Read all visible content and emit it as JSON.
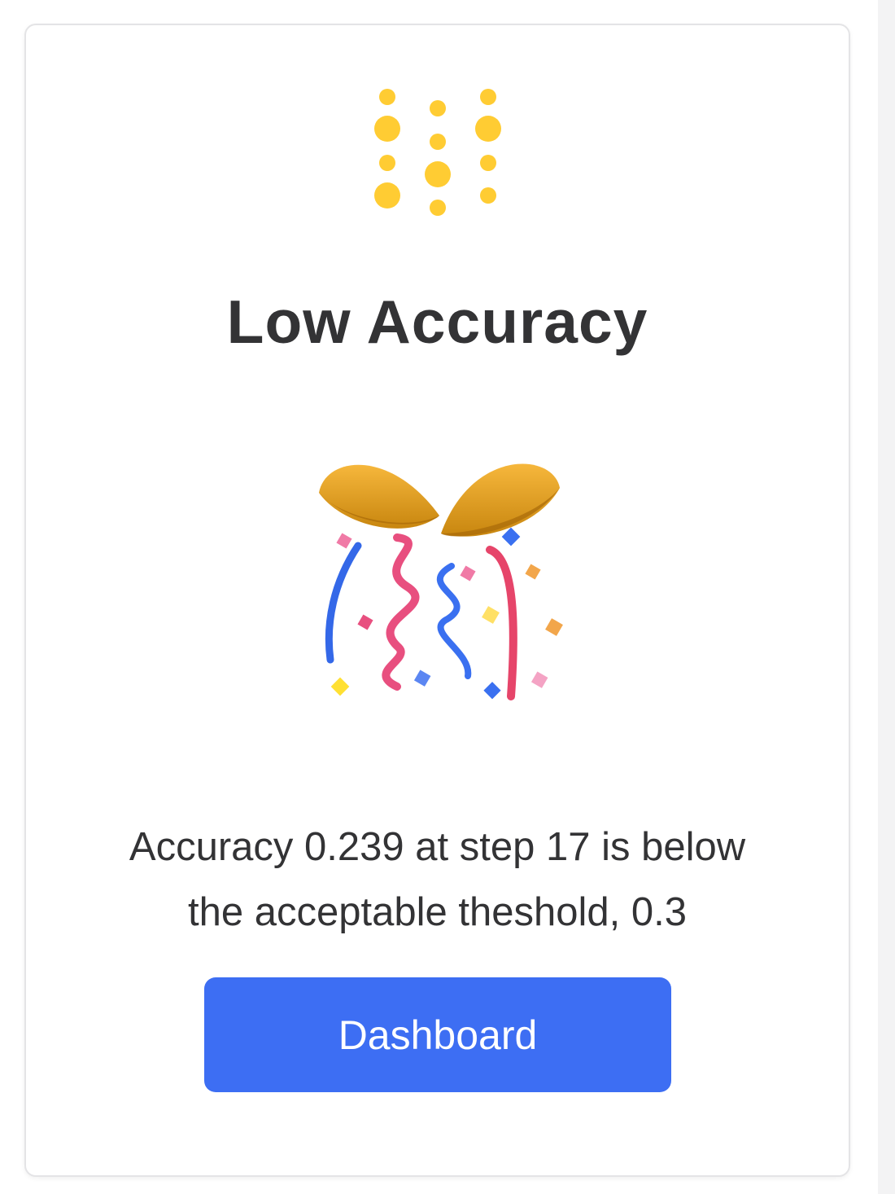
{
  "card": {
    "logo_icon": "wandb-logo-icon",
    "title": "Low Accuracy",
    "emoji_icon": "party-popper-icon",
    "message_line1": "Accuracy 0.239 at step 17 is below",
    "message_line2": "the acceptable theshold, 0.3",
    "button_label": "Dashboard"
  },
  "colors": {
    "logo_dots": "#FFCC33",
    "title_text": "#333335",
    "button_bg": "#3D6EF3",
    "button_text": "#FFFFFF"
  }
}
